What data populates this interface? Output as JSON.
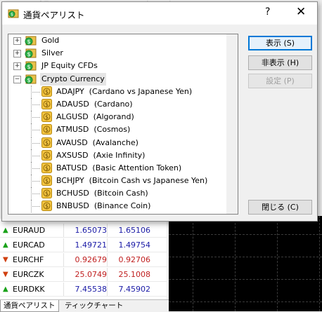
{
  "background": {
    "market_watch": [
      {
        "symbol": "EURAUD",
        "dir": "up",
        "bid": "1.65073",
        "ask": "1.65106"
      },
      {
        "symbol": "EURCAD",
        "dir": "up",
        "bid": "1.49721",
        "ask": "1.49754"
      },
      {
        "symbol": "EURCHF",
        "dir": "down",
        "bid": "0.92679",
        "ask": "0.92706"
      },
      {
        "symbol": "EURCZK",
        "dir": "down",
        "bid": "25.0749",
        "ask": "25.1008"
      },
      {
        "symbol": "EURDKK",
        "dir": "up",
        "bid": "7.45538",
        "ask": "7.45902"
      }
    ],
    "tabs": [
      "通貨ペアリスト",
      "ティックチャート"
    ]
  },
  "dialog": {
    "title": "通貨ペアリスト",
    "help": "?",
    "close": "✕",
    "tree": {
      "folders_before": [
        {
          "label": "Gold",
          "toggle": "+"
        },
        {
          "label": "Silver",
          "toggle": "+"
        },
        {
          "label": "JP Equity CFDs",
          "toggle": "+"
        }
      ],
      "open_folder": {
        "label": "Crypto Currency",
        "toggle": "−"
      },
      "symbols": [
        "ADAJPY  (Cardano vs Japanese Yen)",
        "ADAUSD  (Cardano)",
        "ALGUSD  (Algorand)",
        "ATMUSD  (Cosmos)",
        "AVAUSD  (Avalanche)",
        "AXSUSD  (Axie Infinity)",
        "BATUSD  (Basic Attention Token)",
        "BCHJPY  (Bitcoin Cash vs Japanese Yen)",
        "BCHUSD  (Bitcoin Cash)",
        "BNBUSD  (Binance Coin)"
      ]
    },
    "buttons": {
      "show": "表示 (S)",
      "hide": "非表示 (H)",
      "settings": "設定 (P)",
      "close": "閉じる (C)"
    }
  }
}
